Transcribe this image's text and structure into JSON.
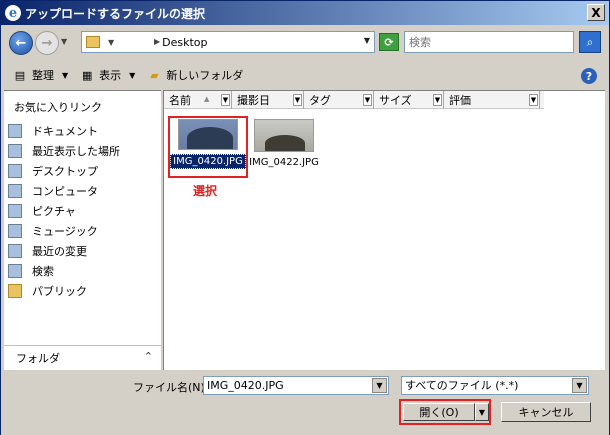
{
  "window": {
    "title": "アップロードするファイルの選択",
    "close_glyph": "X"
  },
  "nav": {
    "address": "Desktop",
    "search_placeholder": "検索"
  },
  "toolbar": {
    "organize": "整理",
    "views": "表示",
    "new_folder": "新しいフォルダ"
  },
  "sidebar": {
    "title": "お気に入りリンク",
    "items": [
      {
        "label": "ドキュメント",
        "icon": "documents-icon"
      },
      {
        "label": "最近表示した場所",
        "icon": "recent-places-icon"
      },
      {
        "label": "デスクトップ",
        "icon": "desktop-icon"
      },
      {
        "label": "コンピュータ",
        "icon": "computer-icon"
      },
      {
        "label": "ピクチャ",
        "icon": "pictures-icon"
      },
      {
        "label": "ミュージック",
        "icon": "music-icon"
      },
      {
        "label": "最近の変更",
        "icon": "recently-changed-icon"
      },
      {
        "label": "検索",
        "icon": "search-icon"
      },
      {
        "label": "パブリック",
        "icon": "public-folder-icon"
      }
    ],
    "folders_label": "フォルダ"
  },
  "columns": [
    "名前",
    "撮影日",
    "タグ",
    "サイズ",
    "評価"
  ],
  "files": [
    {
      "name": "IMG_0420.JPG",
      "selected": true
    },
    {
      "name": "IMG_0422.JPG",
      "selected": false
    }
  ],
  "annotation": {
    "selected_label": "選択",
    "color": "#e02222"
  },
  "footer": {
    "filename_label": "ファイル名(N):",
    "filename_value": "IMG_0420.JPG",
    "filetype_value": "すべてのファイル (*.*)",
    "open_label": "開く(O)",
    "cancel_label": "キャンセル"
  }
}
